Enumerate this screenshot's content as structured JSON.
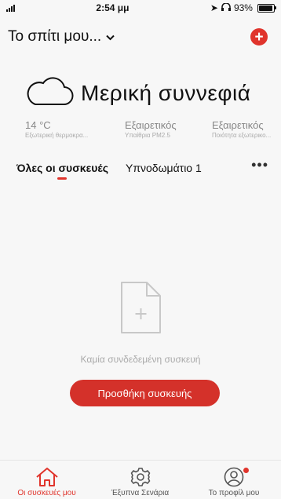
{
  "status_bar": {
    "time": "2:54 μμ",
    "battery": "93%",
    "battery_level": 0.93
  },
  "header": {
    "home_name": "Το σπίτι μου...",
    "add_icon": "plus-circle-icon"
  },
  "weather": {
    "condition": "Μερική συννεφιά",
    "icon": "cloud-icon"
  },
  "metrics": [
    {
      "value": "14 °C",
      "label": "Εξωτερική θερμοκρα..."
    },
    {
      "value": "Εξαιρετικός",
      "label": "Υπαίθρια PM2.5"
    },
    {
      "value": "Εξαιρετικός",
      "label": "Ποιότητα εξωτερικο..."
    }
  ],
  "tabs": [
    {
      "label": "Όλες οι συσκευές",
      "active": true
    },
    {
      "label": "Υπνοδωμάτιο 1",
      "active": false
    }
  ],
  "empty_state": {
    "message": "Καμία συνδεδεμένη συσκευή",
    "button": "Προσθήκη συσκευής"
  },
  "bottom_nav": [
    {
      "label": "Οι συσκευές μου",
      "icon": "home-icon",
      "active": true
    },
    {
      "label": "Έξυπνα Σενάρια",
      "icon": "gear-icon",
      "active": false
    },
    {
      "label": "Το προφίλ μου",
      "icon": "profile-icon",
      "active": false
    }
  ],
  "colors": {
    "accent": "#e0342c",
    "background": "#f7f7f7"
  }
}
